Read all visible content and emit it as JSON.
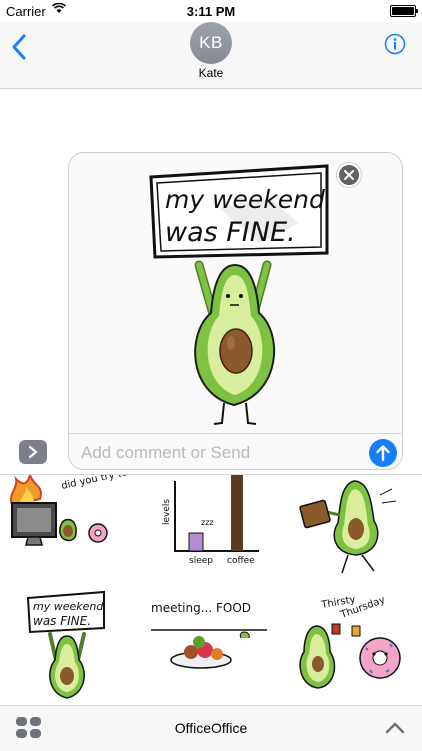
{
  "status": {
    "carrier": "Carrier",
    "time": "3:11 PM"
  },
  "header": {
    "avatar_initials": "KB",
    "contact_name": "Kate"
  },
  "preview": {
    "sticker_caption_line1": "my weekend",
    "sticker_caption_line2": "was FINE.",
    "comment_placeholder": "Add comment or Send"
  },
  "stickers": [
    {
      "caption": "did you try turning it off and on?"
    },
    {
      "ylabel": "levels",
      "note": "zzz",
      "xlabel1": "sleep",
      "xlabel2": "coffee"
    },
    {
      "caption": ""
    },
    {
      "caption_line1": "my weekend",
      "caption_line2": "was FINE."
    },
    {
      "caption": "meeting... FOOD"
    },
    {
      "caption_line1": "Thirsty",
      "caption_line2": "Thursday"
    }
  ],
  "bottombar": {
    "app_name": "OfficeOffice"
  },
  "colors": {
    "accent": "#157efb",
    "avocado_skin": "#7dc242",
    "avocado_flesh": "#d8ee9c",
    "pit": "#8b5a2b",
    "donut": "#f5a3c7"
  }
}
